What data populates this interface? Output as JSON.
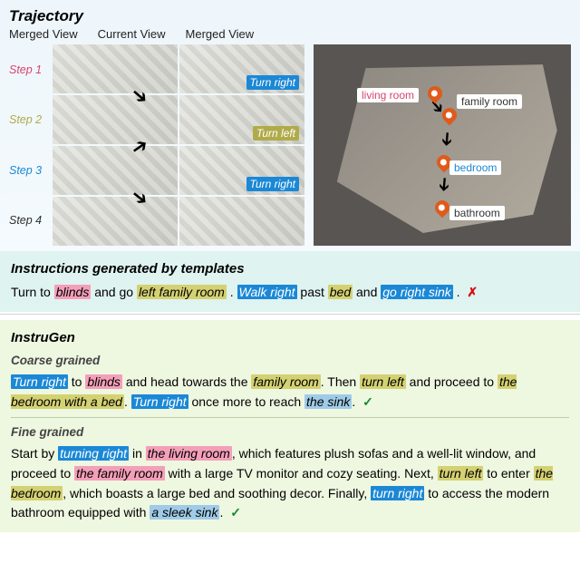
{
  "traj": {
    "title": "Trajectory",
    "headers": [
      "Merged View",
      "Current View",
      "Merged View"
    ],
    "steps": [
      "Step 1",
      "Step 2",
      "Step 3",
      "Step 4"
    ],
    "actions": {
      "s1": "Turn right",
      "s2": "Turn left",
      "s3": "Turn right"
    },
    "rooms": {
      "living": "living room",
      "family": "family room",
      "bedroom": "bedroom",
      "bathroom": "bathroom"
    }
  },
  "tmpl": {
    "title": "Instructions generated by templates",
    "sentence": {
      "w1": "Turn to ",
      "h1": "blinds",
      "w2": " and go ",
      "h2": "left family room",
      "w3": " . ",
      "h3": "Walk right",
      "w4": " past ",
      "h4": "bed",
      "w5": " and ",
      "h5": "go right sink",
      "w6": " ."
    },
    "mark": "✗"
  },
  "ours": {
    "title": "InstruGen",
    "coarse_title": "Coarse grained",
    "coarse": {
      "h1": "Turn right",
      "w1": " to ",
      "h2": "blinds",
      "w2": " and head towards the ",
      "h3": "family room",
      "w3": ". Then ",
      "h4": "turn left",
      "w4": " and proceed to ",
      "h5": "the bedroom with a bed",
      "w5": ". ",
      "h6": "Turn right",
      "w6": " once more to reach ",
      "h7": "the sink",
      "w7": "."
    },
    "coarse_mark": "✓",
    "fine_title": "Fine grained",
    "fine": {
      "w0": "Start by ",
      "h1": "turning right",
      "w1": " in ",
      "h2": "the living room",
      "w2": ", which features plush sofas and a well-lit window, and proceed to ",
      "h3": "the family room",
      "w3": " with a large TV monitor and cozy seating. Next, ",
      "h4": "turn left",
      "w4": " to enter ",
      "h5": "the bedroom",
      "w5": ", which boasts a large bed and soothing decor. Finally, ",
      "h6": "turn right",
      "w6": " to access the modern bathroom equipped with ",
      "h7": "a sleek sink",
      "w7": "."
    },
    "fine_mark": "✓"
  }
}
